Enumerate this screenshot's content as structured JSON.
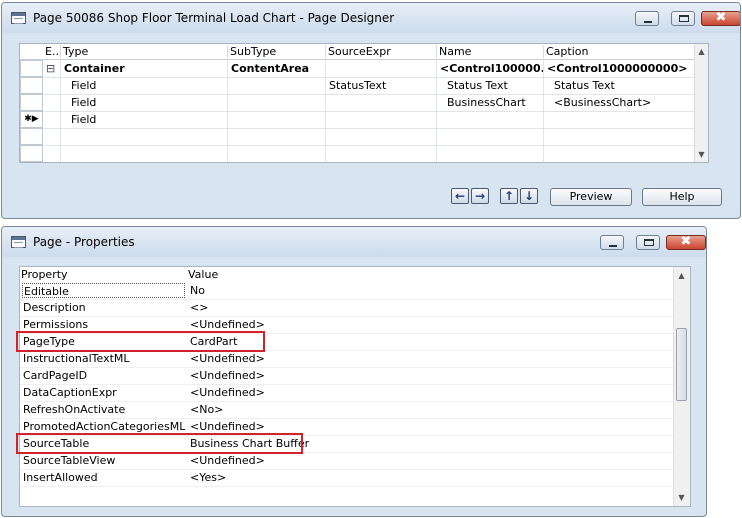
{
  "designer": {
    "title": "Page 50086 Shop Floor Terminal Load Chart - Page Designer",
    "columns": [
      "E..",
      "Type",
      "SubType",
      "SourceExpr",
      "Name",
      "Caption"
    ],
    "rows": [
      {
        "marker": "",
        "expand": "⊟",
        "type": "Container",
        "subtype": "ContentArea",
        "sourceexpr": "",
        "name": "<Control100000...",
        "caption": "<Control1000000000>",
        "bold": true
      },
      {
        "marker": "",
        "expand": "",
        "type": "Field",
        "subtype": "",
        "sourceexpr": "StatusText",
        "name": "Status Text",
        "caption": "Status Text",
        "bold": false
      },
      {
        "marker": "",
        "expand": "",
        "type": "Field",
        "subtype": "",
        "sourceexpr": "",
        "name": "BusinessChart",
        "caption": "<BusinessChart>",
        "bold": false
      },
      {
        "marker": "✱▶",
        "expand": "",
        "type": "Field",
        "subtype": "",
        "sourceexpr": "",
        "name": "",
        "caption": "",
        "bold": false
      },
      {
        "marker": "",
        "expand": "",
        "type": "",
        "subtype": "",
        "sourceexpr": "",
        "name": "",
        "caption": "",
        "bold": false
      },
      {
        "marker": "",
        "expand": "",
        "type": "",
        "subtype": "",
        "sourceexpr": "",
        "name": "",
        "caption": "",
        "bold": false
      }
    ],
    "buttons": {
      "left_arrow": "←",
      "right_arrow": "→",
      "up_arrow": "↑",
      "down_arrow": "↓",
      "preview": "Preview",
      "help": "Help"
    }
  },
  "properties": {
    "title": "Page - Properties",
    "columns": [
      "Property",
      "Value"
    ],
    "rows": [
      {
        "property": "Editable",
        "value": "No"
      },
      {
        "property": "Description",
        "value": "<>"
      },
      {
        "property": "Permissions",
        "value": "<Undefined>"
      },
      {
        "property": "PageType",
        "value": "CardPart"
      },
      {
        "property": "InstructionalTextML",
        "value": "<Undefined>"
      },
      {
        "property": "CardPageID",
        "value": "<Undefined>"
      },
      {
        "property": "DataCaptionExpr",
        "value": "<Undefined>"
      },
      {
        "property": "RefreshOnActivate",
        "value": "<No>"
      },
      {
        "property": "PromotedActionCategoriesML",
        "value": "<Undefined>"
      },
      {
        "property": "SourceTable",
        "value": "Business Chart Buffer"
      },
      {
        "property": "SourceTableView",
        "value": "<Undefined>"
      },
      {
        "property": "InsertAllowed",
        "value": "<Yes>"
      }
    ]
  },
  "window_controls": {
    "minimize": "minimize",
    "maximize": "maximize",
    "close": "✖"
  },
  "colors": {
    "highlight": "#d2222a",
    "window_frame": "#d9e4f1"
  }
}
